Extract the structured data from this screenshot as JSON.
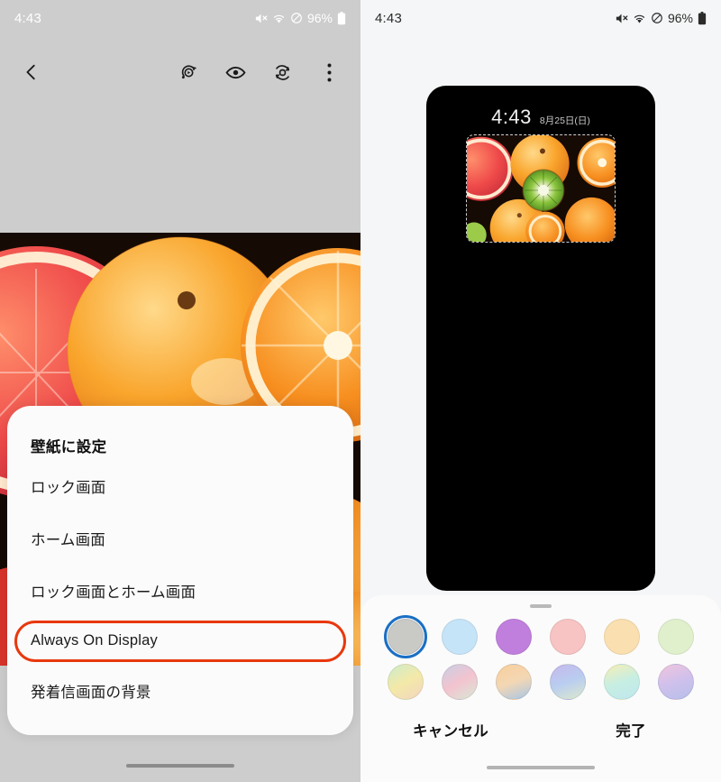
{
  "left": {
    "statusbar": {
      "time": "4:43",
      "battery": "96%",
      "icons": [
        "mute-icon",
        "wifi-icon",
        "do-not-disturb-icon",
        "battery-icon"
      ]
    },
    "toolbar": {
      "back": "back-arrow-icon",
      "actions": [
        "motion-photo-icon",
        "eye-view-icon",
        "bixby-vision-icon",
        "more-options-icon"
      ]
    },
    "sheet": {
      "title": "壁紙に設定",
      "items": [
        {
          "label": "ロック画面",
          "highlighted": false
        },
        {
          "label": "ホーム画面",
          "highlighted": false
        },
        {
          "label": "ロック画面とホーム画面",
          "highlighted": false
        },
        {
          "label": "Always On Display",
          "highlighted": true
        },
        {
          "label": "発着信画面の背景",
          "highlighted": false
        }
      ],
      "highlight_color": "#e8380d"
    }
  },
  "right": {
    "statusbar": {
      "time": "4:43",
      "battery": "96%",
      "icons": [
        "mute-icon",
        "wifi-icon",
        "do-not-disturb-icon",
        "battery-icon"
      ]
    },
    "preview": {
      "clock_time": "4:43",
      "clock_date": "8月25日(日)",
      "background_color": "#000000"
    },
    "palette": {
      "selected_index": 0,
      "swatches": [
        {
          "name": "grey",
          "css": "#c9c9c5",
          "selected": true
        },
        {
          "name": "light-blue",
          "css": "#c6e4f7",
          "selected": false
        },
        {
          "name": "purple",
          "css": "#c07fdd",
          "selected": false
        },
        {
          "name": "pink",
          "css": "#f7c3c3",
          "selected": false
        },
        {
          "name": "peach",
          "css": "#fadfb0",
          "selected": false
        },
        {
          "name": "light-green",
          "css": "#e0f0cd",
          "selected": false
        },
        {
          "name": "green-yellow-gradient",
          "css": "linear-gradient(150deg,#cdeccb,#f3e9a8,#f3d5c0)",
          "selected": false
        },
        {
          "name": "pink-grey-gradient",
          "css": "linear-gradient(150deg,#c9cfe4,#f3c3cf,#d8e8d6)",
          "selected": false
        },
        {
          "name": "orange-blue-gradient",
          "css": "linear-gradient(160deg,#f9cf9c,#f3d7b4,#a8c6e6)",
          "selected": false
        },
        {
          "name": "blue-purple-gradient",
          "css": "linear-gradient(160deg,#c6b8ec,#b9cdf0,#dce9cd)",
          "selected": false
        },
        {
          "name": "yellow-teal-gradient",
          "css": "linear-gradient(160deg,#f6eeb6,#c7eee2,#bfe7ee)",
          "selected": false
        },
        {
          "name": "pink-violet-gradient",
          "css": "linear-gradient(160deg,#f0c5dd,#cfc0ec,#b6c0ea)",
          "selected": false
        }
      ]
    },
    "actions": {
      "cancel": "キャンセル",
      "done": "完了"
    }
  }
}
